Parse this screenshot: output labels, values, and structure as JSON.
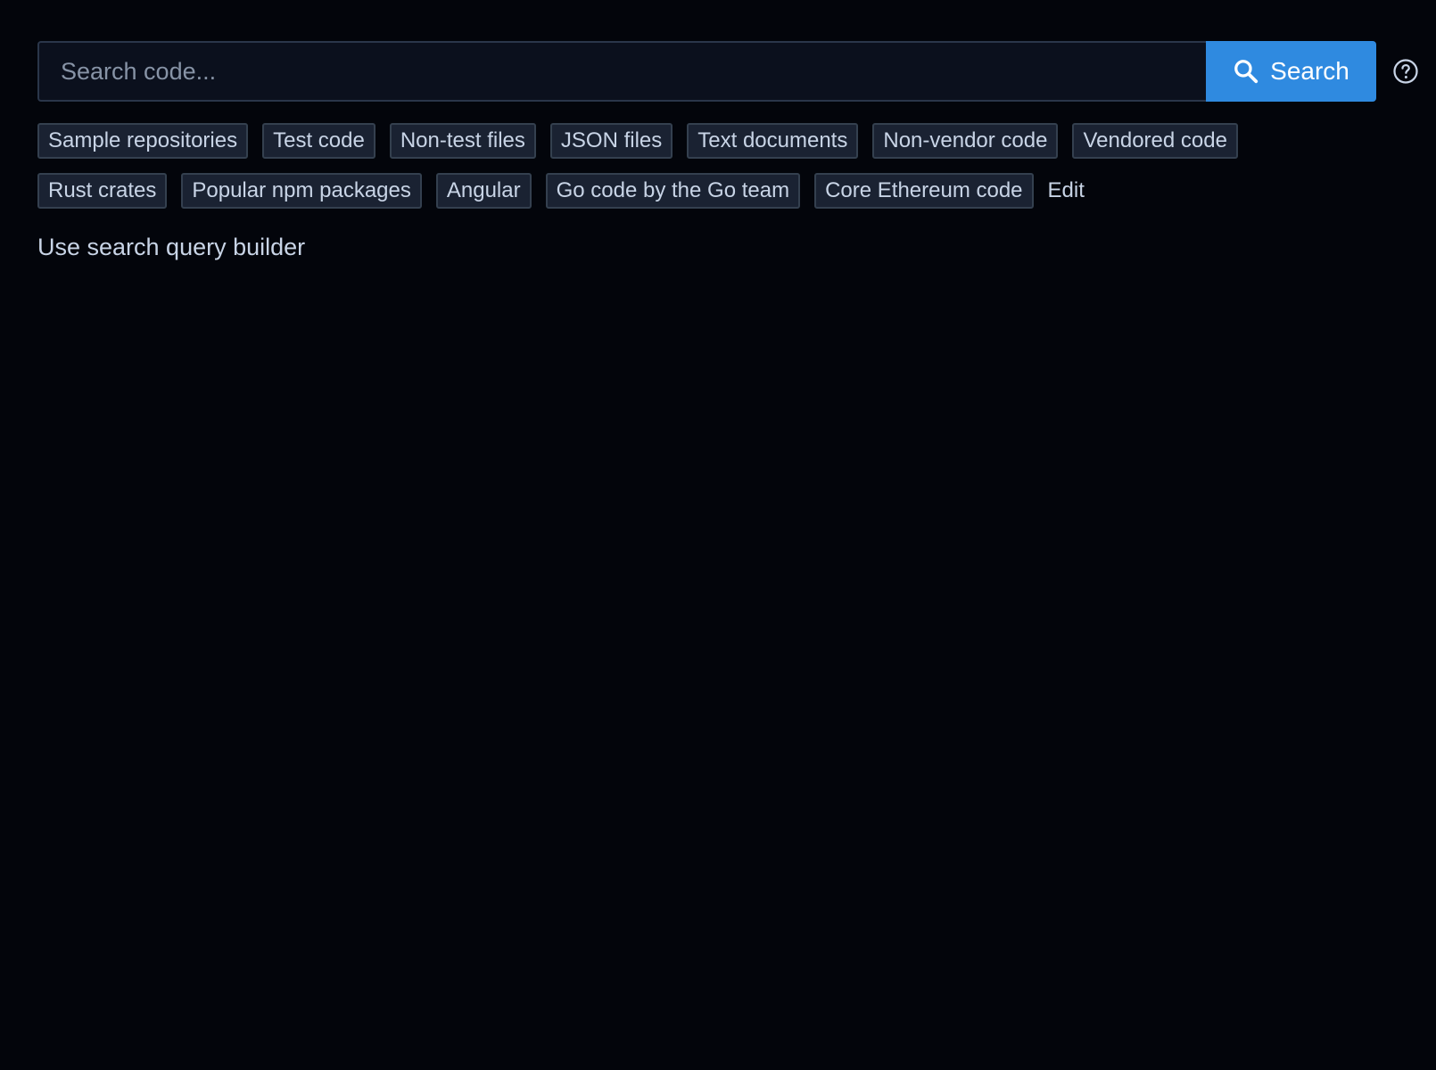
{
  "search": {
    "placeholder": "Search code...",
    "value": "",
    "button_label": "Search",
    "button_icon": "search-icon",
    "help_icon": "help-circle-icon"
  },
  "chips": {
    "row1": [
      {
        "label": "Sample repositories"
      },
      {
        "label": "Test code"
      },
      {
        "label": "Non-test files"
      },
      {
        "label": "JSON files"
      },
      {
        "label": "Text documents"
      },
      {
        "label": "Non-vendor code"
      },
      {
        "label": "Vendored code"
      }
    ],
    "row2": [
      {
        "label": "Rust crates"
      },
      {
        "label": "Popular npm packages"
      },
      {
        "label": "Angular"
      },
      {
        "label": "Go code by the Go team"
      },
      {
        "label": "Core Ethereum code"
      }
    ],
    "edit_label": "Edit"
  },
  "query_builder": {
    "label": "Use search query builder"
  },
  "colors": {
    "background": "#03050b",
    "accent": "#2f8ae0",
    "chip_bg": "#1a2232",
    "text": "#c8d4e6"
  }
}
